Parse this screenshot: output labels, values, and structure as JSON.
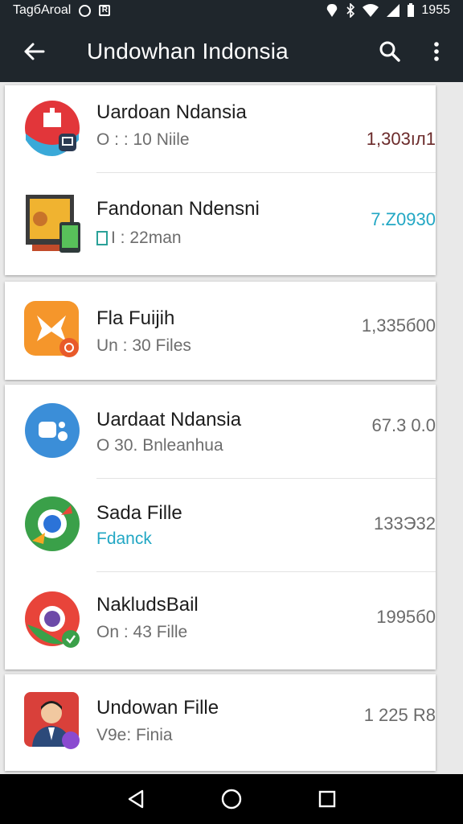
{
  "status_bar": {
    "carrier": "TagбAroal",
    "time": "1955"
  },
  "app_bar": {
    "title": "Undowhan Indonsia"
  },
  "colors": {
    "appbar": "#1f262c",
    "accent_teal": "#22a7c4",
    "accent_dark_red": "#7a1d1d"
  },
  "items": [
    {
      "title": "Uardoan Ndansia",
      "subtitle": "O : : 10 Niile",
      "value": "1,303ıл1",
      "icon": "red-app-icon"
    },
    {
      "title": "Fandonan Ndensni",
      "subtitle": "I : 22man",
      "value": "7.Z0930",
      "icon": "monitor-phone-icon"
    },
    {
      "title": "Fla Fuijih",
      "subtitle": "Un : 30 Files",
      "value": "1,335б00",
      "icon": "orange-x-icon"
    },
    {
      "title": "Uardaat Ndansia",
      "subtitle": "O 30. Bnleanhua",
      "value": "67.3 0.0",
      "icon": "blue-chat-icon"
    },
    {
      "title": "Sada Fille",
      "subtitle": "Fdanck",
      "value": "133Э32",
      "icon": "green-circle-icon"
    },
    {
      "title": "NakludsBail",
      "subtitle": "On : 43 Fille",
      "value": "1995б0",
      "icon": "red-green-circle-icon"
    },
    {
      "title": "Undowan Fille",
      "subtitle": "V9e: Finia",
      "value": "1 225 R8",
      "icon": "person-icon"
    }
  ],
  "nav": {
    "back": "back-icon",
    "home": "home-icon",
    "recents": "recents-icon"
  }
}
